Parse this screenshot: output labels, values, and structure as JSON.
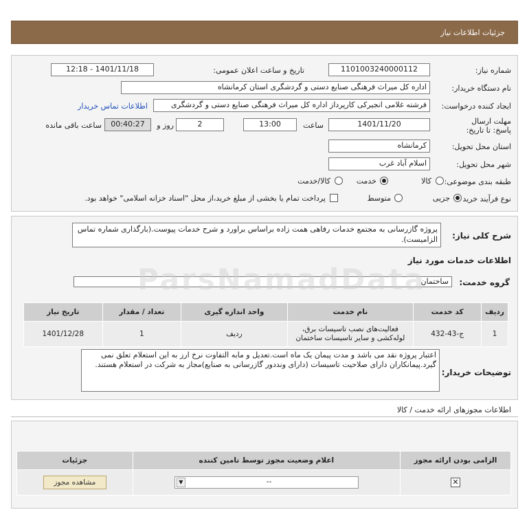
{
  "header": {
    "title": "جزئیات اطلاعات نیاز"
  },
  "info": {
    "need_number_label": "شماره نیاز:",
    "need_number_value": "1101003240000112",
    "announce_label": "تاریخ و ساعت اعلان عمومی:",
    "announce_value": "1401/11/18 - 12:18",
    "buyer_label": "نام دستگاه خریدار:",
    "buyer_value": "اداره کل میراث فرهنگی  صنایع دستی و گردشگری استان کرمانشاه",
    "requester_label": "ایجاد کننده درخواست:",
    "requester_value": "فرشته غلامی انجیرکی کارپرداز اداره کل میراث فرهنگی  صنایع دستی و گردشگری",
    "contact_link": "اطلاعات تماس خریدار",
    "deadline_label": "مهلت ارسال پاسخ: تا تاریخ:",
    "deadline_date": "1401/11/20",
    "time_label": "ساعت",
    "deadline_time": "13:00",
    "days_value": "2",
    "days_label": "روز و",
    "remaining_value": "00:40:27",
    "remaining_label": "ساعت باقی مانده",
    "province_label": "استان محل تحویل:",
    "province_value": "کرمانشاه",
    "city_label": "شهر محل تحویل:",
    "city_value": "اسلام آباد غرب",
    "category_label": "طبقه بندی موضوعی:",
    "category_options": [
      "کالا",
      "خدمت",
      "کالا/خدمت"
    ],
    "purchase_type_label": "نوع فرآیند خرید :",
    "purchase_options": [
      "جزیی",
      "متوسط"
    ],
    "payment_note": "پرداخت تمام یا بخشی از مبلغ خرید،از محل \"اسناد خزانه اسلامی\" خواهد بود."
  },
  "general": {
    "desc_label": "شرح کلی نیاز:",
    "desc_value": "پروژه گازرسانی به مجتمع خدمات رفاهی همت زاده براساس براورد و شرح خدمات پیوست.(بارگذاری شماره تماس الزامیست).",
    "services_title": "اطلاعات خدمات مورد نیاز",
    "service_group_label": "گروه خدمت:",
    "service_group_value": "ساختمان"
  },
  "table": {
    "headers": [
      "ردیف",
      "کد خدمت",
      "نام خدمت",
      "واحد اندازه گیری",
      "تعداد / مقدار",
      "تاریخ نیاز"
    ],
    "rows": [
      [
        "1",
        "ج-43-432",
        "فعالیت‌های نصب تاسیسات برق، لوله‌کشی و سایر تاسیسات ساختمان",
        "ردیف",
        "1",
        "1401/12/28"
      ]
    ]
  },
  "buyer_notes": {
    "label": "توضیحات خریدار:",
    "value": "اعتبار پروژه نقد می باشد و مدت پیمان یک ماه است.تعدیل و مابه التفاوت نرخ ارز به این استعلام تعلق نمی گیرد.پیمانکاران دارای صلاحیت تاسیسات (دارای ونددور گازرسانی به صنایع)مجاز به شرکت در استعلام هستند."
  },
  "permits": {
    "title": "اطلاعات مجوزهای ارائه خدمت / کالا",
    "headers": [
      "الزامی بودن ارائه مجوز",
      "اعلام وضعیت مجوز توسط تامین کننده",
      "جزئیات"
    ],
    "select_value": "--",
    "view_button": "مشاهده مجوز"
  },
  "watermark": {
    "text": "ParsNamadData"
  }
}
